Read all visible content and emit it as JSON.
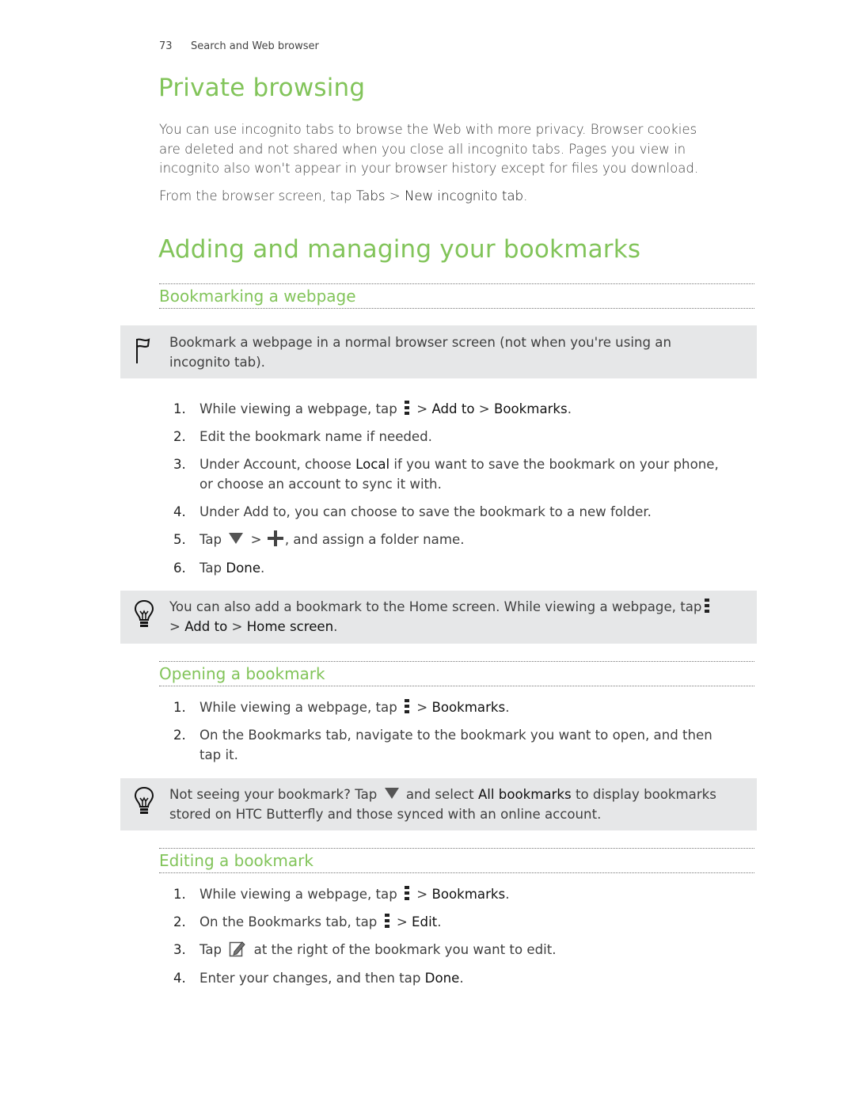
{
  "header": {
    "page_number": "73",
    "section": "Search and Web browser"
  },
  "private_browsing": {
    "title": "Private browsing",
    "paragraph": [
      "You can use incognito tabs to browse the Web with more privacy. Browser cookies",
      "are deleted and not shared when you close all incognito tabs. Pages you view in",
      "incognito also won't appear in your browser history except for files you download."
    ],
    "instruction": {
      "prefix": "From the browser screen, tap ",
      "tabs": "Tabs",
      "sep": " > ",
      "new_tab": "New incognito tab",
      "suffix": "."
    }
  },
  "bookmarks": {
    "title": "Adding and managing your bookmarks",
    "bookmarking": {
      "subhead": "Bookmarking a webpage",
      "note": [
        "Bookmark a webpage in a normal browser screen (not when you're using an",
        "incognito tab)."
      ],
      "steps": [
        {
          "num": "1.",
          "a": "While viewing a webpage, tap ",
          "b": " > ",
          "c": "Add to",
          "d": " > ",
          "e": "Bookmarks",
          "f": "."
        },
        {
          "num": "2.",
          "text": "Edit the bookmark name if needed."
        },
        {
          "num": "3.",
          "a": "Under Account, choose ",
          "b": "Local",
          "c": " if you want to save the bookmark on your phone,",
          "line2": "or choose an account to sync it with."
        },
        {
          "num": "4.",
          "text": "Under Add to, you can choose to save the bookmark to a new folder."
        },
        {
          "num": "5.",
          "a": "Tap ",
          "b": " > ",
          "c": ", and assign a folder name."
        },
        {
          "num": "6.",
          "a": "Tap ",
          "b": "Done",
          "c": "."
        }
      ],
      "tip": {
        "a": "You can also add a bookmark to the Home screen. While viewing a webpage, tap",
        "b": "> ",
        "c": "Add to",
        "d": " > ",
        "e": "Home screen",
        "f": "."
      }
    },
    "opening": {
      "subhead": "Opening a bookmark",
      "steps": [
        {
          "num": "1.",
          "a": "While viewing a webpage, tap ",
          "b": " > ",
          "c": "Bookmarks",
          "d": "."
        },
        {
          "num": "2.",
          "text": "On the Bookmarks tab, navigate to the bookmark you want to open, and then",
          "line2": "tap it."
        }
      ],
      "tip": {
        "a": "Not seeing your bookmark? Tap ",
        "b": " and select ",
        "c": "All bookmarks",
        "d": " to display bookmarks",
        "line2": "stored on HTC Butterfly and those synced with an online account."
      }
    },
    "editing": {
      "subhead": "Editing a bookmark",
      "steps": [
        {
          "num": "1.",
          "a": "While viewing a webpage, tap ",
          "b": " > ",
          "c": "Bookmarks",
          "d": "."
        },
        {
          "num": "2.",
          "a": "On the Bookmarks tab, tap ",
          "b": " > ",
          "c": "Edit",
          "d": "."
        },
        {
          "num": "3.",
          "a": "Tap ",
          "b": " at the right of the bookmark you want to edit."
        },
        {
          "num": "4.",
          "a": "Enter your changes, and then tap ",
          "b": "Done",
          "c": "."
        }
      ]
    }
  },
  "colors": {
    "heading_green": "#82c45a",
    "note_bg": "#e6e7e8"
  }
}
